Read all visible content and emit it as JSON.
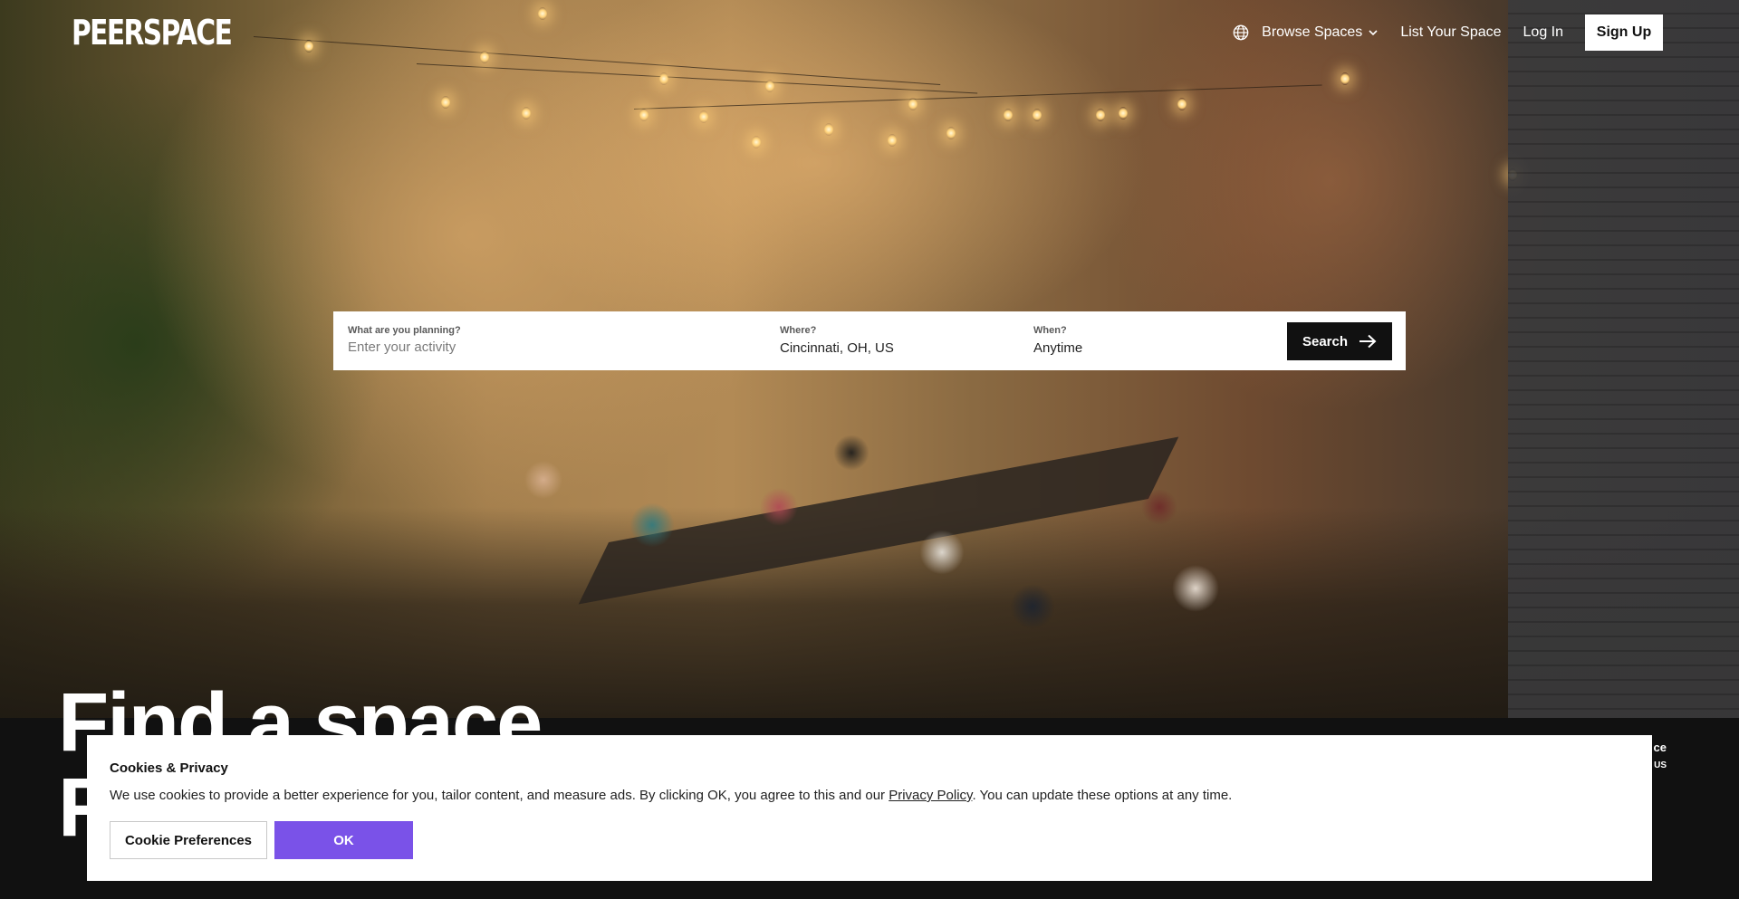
{
  "brand": {
    "logo": "PEERSPACE"
  },
  "nav": {
    "browse_label": "Browse Spaces",
    "list_label": "List Your Space",
    "login_label": "Log In",
    "signup_label": "Sign Up",
    "icons": {
      "globe": "globe-icon",
      "chevron": "chevron-down-icon"
    }
  },
  "search": {
    "activity_label": "What are you planning?",
    "activity_placeholder": "Enter your activity",
    "activity_value": "",
    "where_label": "Where?",
    "where_value": "Cincinnati, OH, US",
    "when_label": "When?",
    "when_value": "Anytime",
    "button_label": "Search",
    "button_icon": "arrow-right-icon"
  },
  "hero": {
    "headline_line1": "Find a space.",
    "headline_line2": "F",
    "side_label_1": "ce",
    "side_label_2": "US"
  },
  "cookie": {
    "title": "Cookies & Privacy",
    "text_before": "We use cookies to provide a better experience for you, tailor content, and measure ads. By clicking OK, you agree to this and our ",
    "link_text": "Privacy Policy",
    "text_after": ". You can update these options at any time.",
    "preferences_label": "Cookie Preferences",
    "ok_label": "OK",
    "ok_color": "#7a52e8"
  }
}
